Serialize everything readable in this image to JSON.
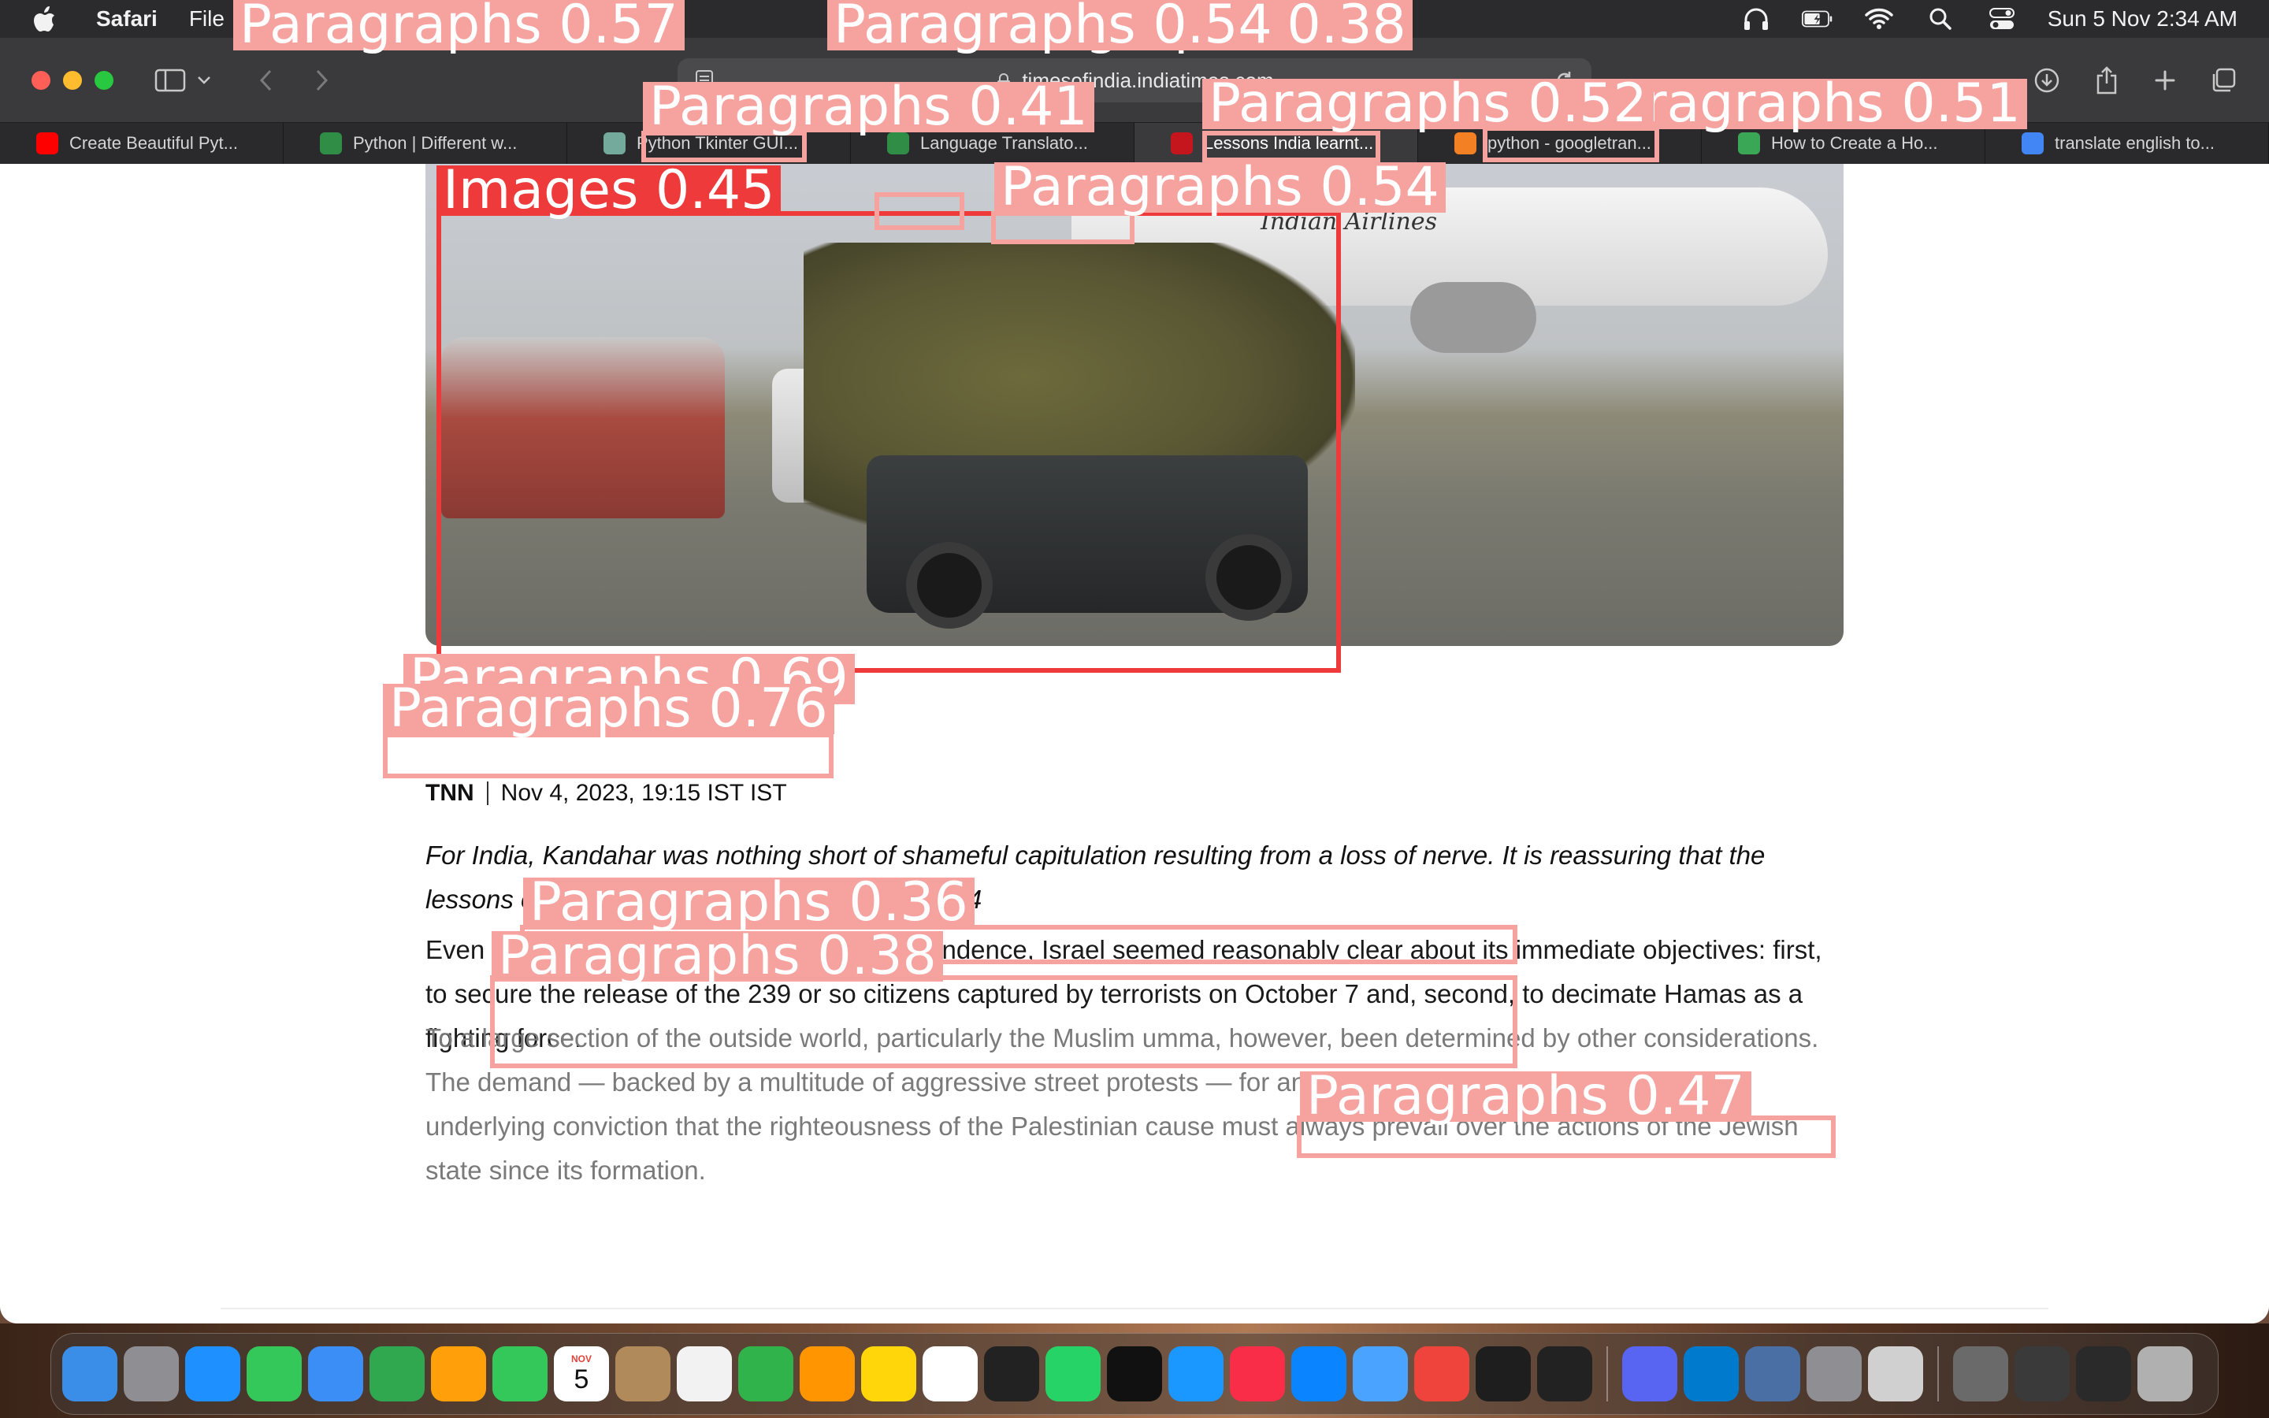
{
  "menubar": {
    "app_name": "Safari",
    "file_menu": "File",
    "datetime": "Sun 5 Nov  2:34 AM"
  },
  "browser": {
    "address": "timesofindia.indiatimes.com",
    "tabs": [
      {
        "label": "Create Beautiful Pyt...",
        "favicon": "youtube-icon",
        "color": "#ff0000"
      },
      {
        "label": "Python | Different w...",
        "favicon": "geeksforgeeks-icon",
        "color": "#2f8d46"
      },
      {
        "label": "Python Tkinter GUI...",
        "favicon": "chatgpt-icon",
        "color": "#74aa9c"
      },
      {
        "label": "Language Translato...",
        "favicon": "geeksforgeeks-icon",
        "color": "#2f8d46"
      },
      {
        "label": "Lessons India learnt...",
        "favicon": "toi-icon",
        "color": "#c4161c",
        "active": true
      },
      {
        "label": "python - googletran...",
        "favicon": "stackoverflow-icon",
        "color": "#f48024"
      },
      {
        "label": "How to Create a Ho...",
        "favicon": "f-icon",
        "color": "#3aa757"
      },
      {
        "label": "translate english to...",
        "favicon": "google-icon",
        "color": "#4285f4"
      }
    ]
  },
  "article": {
    "hero_caption_text": "Indian Airlines",
    "author": "TNN",
    "date": "Nov 4, 2023, 19:15 IST IST",
    "summary": "For India, Kandahar was nothing short of shameful capitulation resulting from a loss of nerve. It is reassuring that the lessons of this humiliation were learnt after 2014",
    "para1": "Even at the start of its Second War of Independence, Israel seemed reasonably clear about its immediate objectives: first, to secure the release of the 239 or so citizens captured by terrorists on October 7 and, second, to decimate Hamas as a fighting force.",
    "para2": "To a large section of the outside world, particularly the Muslim umma, however, been determined by other considerations. The demand — backed by a multitude of aggressive street protests — for an immediate cease-fire is shaped by the underlying conviction that the righteousness of the Palestinian cause must always prevail over the actions of the Jewish state since its formation."
  },
  "detections": [
    {
      "label": "Paragraphs 0.57"
    },
    {
      "label": "Paragraphs 0.54"
    },
    {
      "label": "Paragraphs 0.38"
    },
    {
      "label": "Paragraphs 0.41"
    },
    {
      "label": "Paragraphs 0.52"
    },
    {
      "label": "Paragraphs 0.51"
    },
    {
      "label": "Images 0.45"
    },
    {
      "label": "Paragraphs 0.54"
    },
    {
      "label": "Paragraphs 0.69"
    },
    {
      "label": "Paragraphs 0.76"
    },
    {
      "label": "Paragraphs 0.36"
    },
    {
      "label": "Paragraphs 0.38"
    },
    {
      "label": "Paragraphs 0.47"
    }
  ],
  "dock": {
    "calendar_month": "NOV",
    "calendar_day": "5",
    "apps": [
      "finder",
      "launchpad",
      "safari",
      "messages",
      "mail",
      "maps",
      "photos",
      "facetime",
      "calendar",
      "contacts",
      "reminders",
      "numbers",
      "pages",
      "notes",
      "freeform",
      "voice-memos",
      "whatsapp",
      "tv",
      "prime-video",
      "music",
      "app-store",
      "weather",
      "anydesk",
      "terminal",
      "l-app",
      "discord",
      "vscode",
      "preview",
      "system-settings",
      "rocket",
      "screenshot-1",
      "screenshot-2",
      "screenshot-3",
      "trash"
    ]
  }
}
